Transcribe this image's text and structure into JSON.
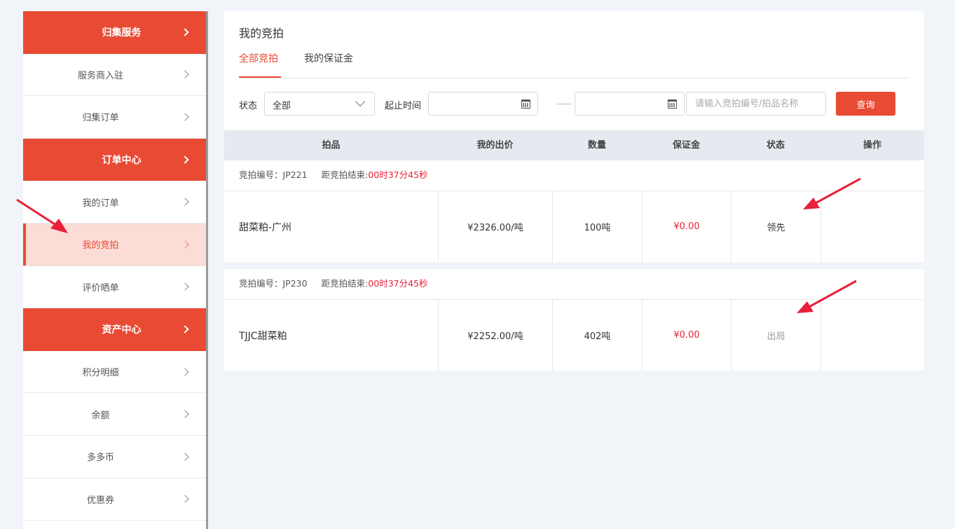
{
  "sidebar": {
    "items": [
      {
        "label": "归集服务",
        "type": "header"
      },
      {
        "label": "服务商入驻",
        "type": "item"
      },
      {
        "label": "归集订单",
        "type": "item"
      },
      {
        "label": "订单中心",
        "type": "header"
      },
      {
        "label": "我的订单",
        "type": "item"
      },
      {
        "label": "我的竞拍",
        "type": "active"
      },
      {
        "label": "评价晒单",
        "type": "item"
      },
      {
        "label": "资产中心",
        "type": "header"
      },
      {
        "label": "积分明细",
        "type": "item"
      },
      {
        "label": "余额",
        "type": "item"
      },
      {
        "label": "多多币",
        "type": "item"
      },
      {
        "label": "优惠券",
        "type": "item"
      }
    ]
  },
  "page": {
    "title": "我的竞拍",
    "tabs": [
      "全部竞拍",
      "我的保证金"
    ]
  },
  "filters": {
    "status_label": "状态",
    "status_value": "全部",
    "date_label": "起止时间",
    "search_placeholder": "请输入竞拍编号/拍品名称",
    "query_button": "查询"
  },
  "table": {
    "headers": [
      "拍品",
      "我的出价",
      "数量",
      "保证金",
      "状态",
      "操作"
    ],
    "orders": [
      {
        "auction_no_label": "竞拍编号：JP221",
        "end_label": "距竞拍结束:",
        "countdown": "00时37分45秒",
        "item": "甜菜粕-广州",
        "bid": "¥2326.00/吨",
        "qty": "100吨",
        "deposit": "¥0.00",
        "status": "领先",
        "action": ""
      },
      {
        "auction_no_label": "竞拍编号：JP230",
        "end_label": "距竞拍结束:",
        "countdown": "00时37分45秒",
        "item": "TJJC甜菜粕",
        "bid": "¥2252.00/吨",
        "qty": "402吨",
        "deposit": "¥0.00",
        "status": "出局",
        "action": ""
      }
    ]
  },
  "colors": {
    "accent": "#e84a33",
    "countdown": "#e8203a",
    "active_bg": "#fbdcd7"
  }
}
